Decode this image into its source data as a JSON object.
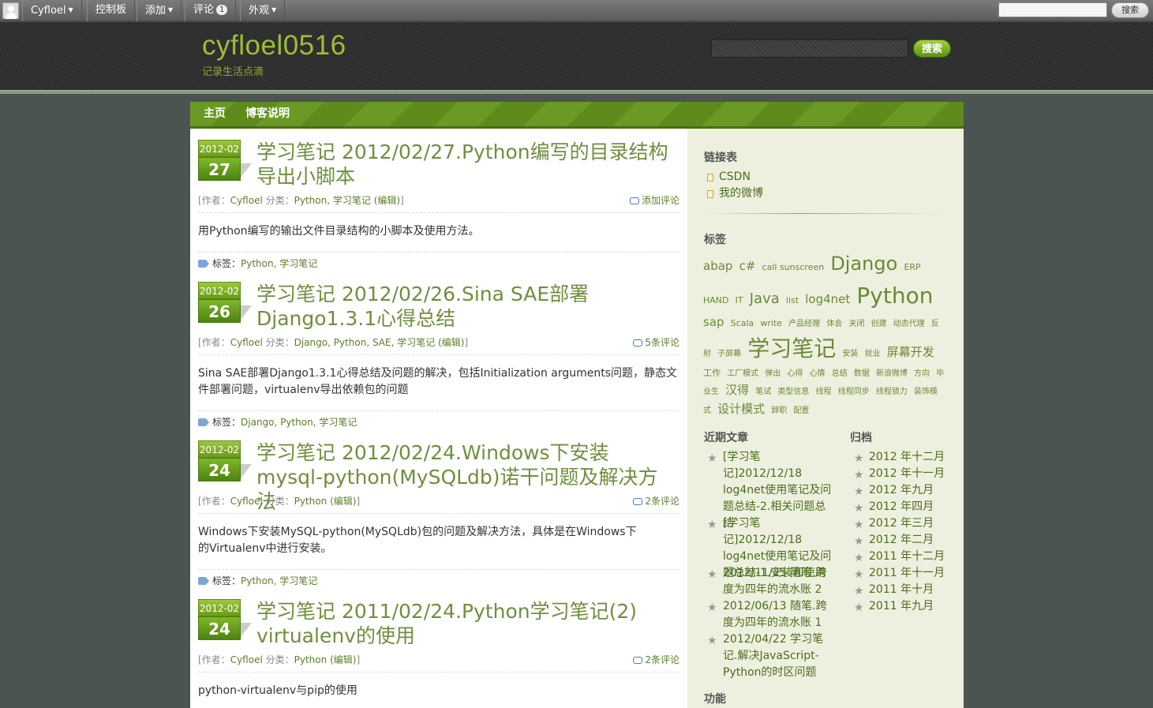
{
  "adminbar": {
    "user": "Cyfloel",
    "items": [
      {
        "label": "控制板"
      },
      {
        "label": "添加"
      },
      {
        "label": "评论",
        "badge": "1"
      },
      {
        "label": "外观"
      }
    ],
    "search_button": "搜索"
  },
  "header": {
    "site_title": "cyfloel0516",
    "site_description": "记录生活点滴",
    "search_button": "搜索"
  },
  "nav": [
    "主页",
    "博客说明"
  ],
  "posts": [
    {
      "ym": "2012-02",
      "day": "27",
      "title": "学习笔记 2012/02/27.Python编写的目录结构导出小脚本",
      "meta_prefix": "[作者：",
      "author": "Cyfloel",
      "category_label": " 分类：",
      "categories": "Python, 学习笔记",
      "edit": "(编辑)",
      "meta_suffix": "]",
      "comments": "添加评论",
      "excerpt": "用Python编写的输出文件目录结构的小脚本及使用方法。",
      "tags_label": "标签：",
      "tags": "Python, 学习笔记"
    },
    {
      "ym": "2012-02",
      "day": "26",
      "title": "学习笔记 2012/02/26.Sina SAE部署Django1.3.1心得总结",
      "meta_prefix": "[作者：",
      "author": "Cyfloel",
      "category_label": " 分类：",
      "categories": "Django, Python, SAE, 学习笔记",
      "edit": "(编辑)",
      "meta_suffix": "]",
      "comments": "5条评论",
      "excerpt": "Sina SAE部署Django1.3.1心得总结及问题的解决，包括Initialization arguments问题，静态文件部署问题，virtualenv导出依赖包的问题",
      "tags_label": "标签：",
      "tags": "Django, Python, 学习笔记"
    },
    {
      "ym": "2012-02",
      "day": "24",
      "title": "学习笔记 2012/02/24.Windows下安装mysql-python(MySQLdb)诺干问题及解决方法",
      "meta_prefix": "[作者：",
      "author": "Cyfloel",
      "category_label": " 分类：",
      "categories": "Python",
      "edit": "(编辑)",
      "meta_suffix": "]",
      "comments": "2条评论",
      "excerpt": "Windows下安装MySQL-python(MySQLdb)包的问题及解决方法，具体是在Windows下的Virtualenv中进行安装。",
      "tags_label": "标签：",
      "tags": "Python, 学习笔记"
    },
    {
      "ym": "2012-02",
      "day": "24",
      "title": "学习笔记 2011/02/24.Python学习笔记(2) virtualenv的使用",
      "meta_prefix": "[作者：",
      "author": "Cyfloel",
      "category_label": " 分类：",
      "categories": "Python",
      "edit": "(编辑)",
      "meta_suffix": "]",
      "comments": "2条评论",
      "excerpt": "python-virtualenv与pip的使用"
    }
  ],
  "sidebar": {
    "links_title": "链接表",
    "links": [
      "CSDN",
      "我的微博"
    ],
    "tags_title": "标签",
    "tagcloud": [
      {
        "t": "abap",
        "s": 15
      },
      {
        "t": "c#",
        "s": 15
      },
      {
        "t": "call sunscreen",
        "s": 11
      },
      {
        "t": "Django",
        "s": 24
      },
      {
        "t": "ERP",
        "s": 11
      },
      {
        "t": "HAND",
        "s": 11
      },
      {
        "t": "IT",
        "s": 11
      },
      {
        "t": "Java",
        "s": 18
      },
      {
        "t": "list",
        "s": 11
      },
      {
        "t": "log4net",
        "s": 15
      },
      {
        "t": "Python",
        "s": 28
      },
      {
        "t": "sap",
        "s": 15
      },
      {
        "t": "Scala",
        "s": 11
      },
      {
        "t": "write",
        "s": 11
      },
      {
        "t": "产品经理",
        "s": 10
      },
      {
        "t": "体会",
        "s": 10
      },
      {
        "t": "关闭",
        "s": 10
      },
      {
        "t": "创建",
        "s": 10
      },
      {
        "t": "动态代理",
        "s": 10
      },
      {
        "t": "反射",
        "s": 10
      },
      {
        "t": "子屏幕",
        "s": 10
      },
      {
        "t": "学习笔记",
        "s": 28
      },
      {
        "t": "安装",
        "s": 10
      },
      {
        "t": "就业",
        "s": 10
      },
      {
        "t": "屏幕开发",
        "s": 15
      },
      {
        "t": "工作",
        "s": 11
      },
      {
        "t": "工厂模式",
        "s": 10
      },
      {
        "t": "弹出",
        "s": 10
      },
      {
        "t": "心得",
        "s": 10
      },
      {
        "t": "心情",
        "s": 10
      },
      {
        "t": "总结",
        "s": 10
      },
      {
        "t": "数据",
        "s": 10
      },
      {
        "t": "新浪微博",
        "s": 10
      },
      {
        "t": "方向",
        "s": 10
      },
      {
        "t": "毕业生",
        "s": 10
      },
      {
        "t": "汉得",
        "s": 15
      },
      {
        "t": "笔试",
        "s": 10
      },
      {
        "t": "类型信息",
        "s": 10
      },
      {
        "t": "线程",
        "s": 10
      },
      {
        "t": "线程同步",
        "s": 10
      },
      {
        "t": "线程锁力",
        "s": 10
      },
      {
        "t": "装饰模式",
        "s": 10
      },
      {
        "t": "设计模式",
        "s": 15
      },
      {
        "t": "辞职",
        "s": 10
      },
      {
        "t": "配置",
        "s": 10
      }
    ],
    "recent_title": "近期文章",
    "recent": [
      "[学习笔记]2012/12/18 log4net使用笔记及问题总结-2.相关问题总结",
      "[学习笔记]2012/12/18 log4net使用笔记及问题总结-1.安装和使用",
      "2012/11/25 随笔.跨度为四年的流水账 2",
      "2012/06/13 随笔.跨度为四年的流水账 1",
      "2012/04/22 学习笔记.解决JavaScript-Python的时区问题"
    ],
    "archives_title": "归档",
    "archives": [
      "2012 年十二月",
      "2012 年十一月",
      "2012 年九月",
      "2012 年四月",
      "2012 年三月",
      "2012 年二月",
      "2011 年十二月",
      "2011 年十一月",
      "2011 年十月",
      "2011 年九月"
    ],
    "meta_title": "功能"
  }
}
